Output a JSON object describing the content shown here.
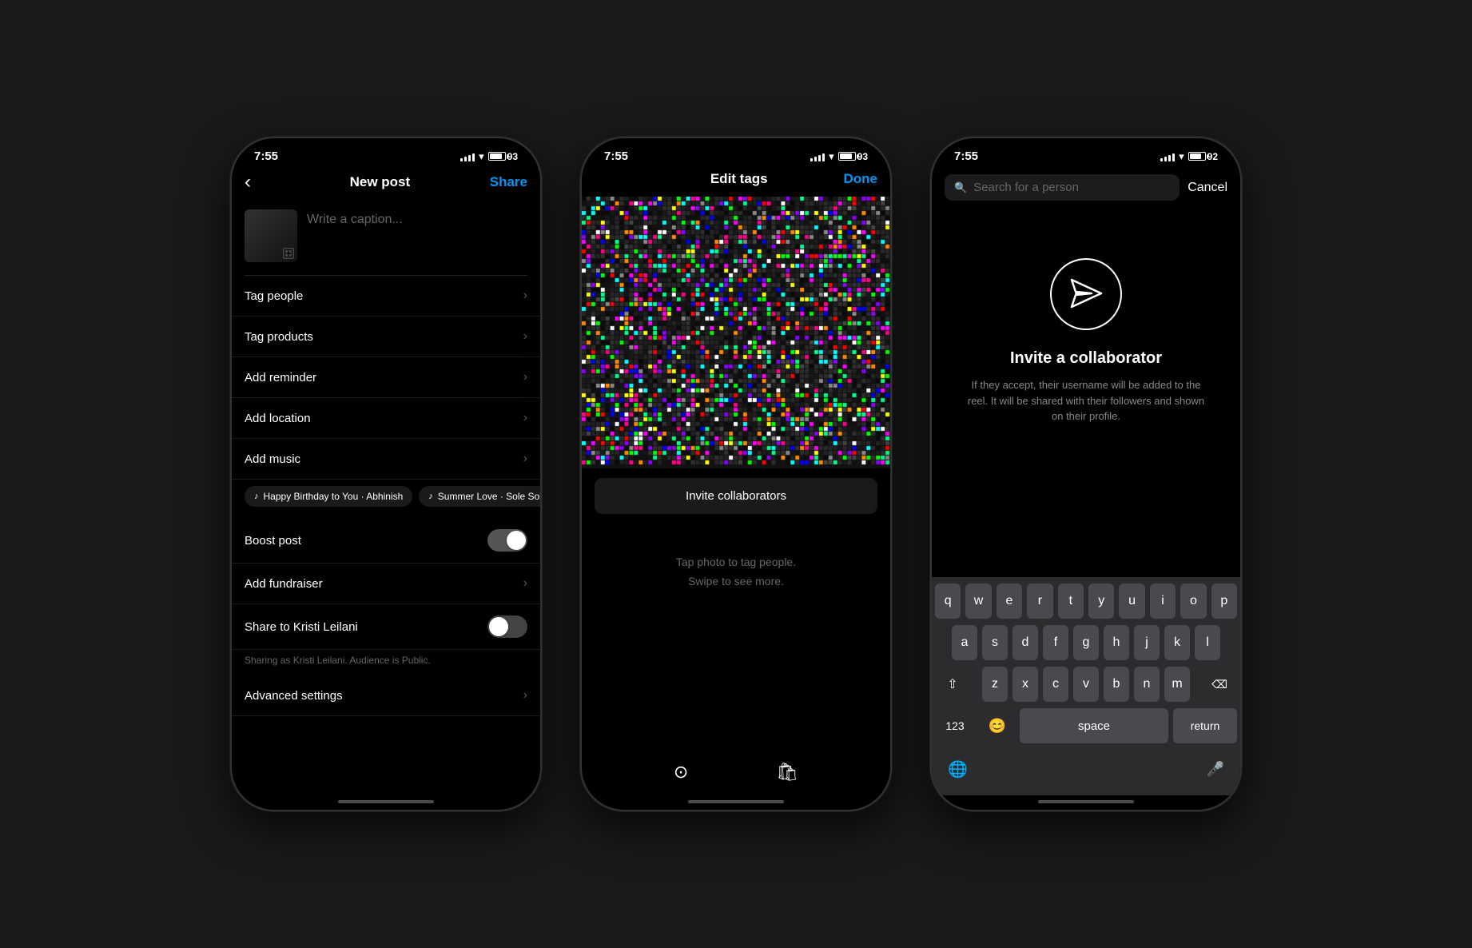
{
  "phone1": {
    "status": {
      "time": "7:55",
      "battery": "93"
    },
    "nav": {
      "back": "‹",
      "title": "New post",
      "share": "Share"
    },
    "caption_placeholder": "Write a caption...",
    "menu_items": [
      {
        "label": "Tag people"
      },
      {
        "label": "Tag products"
      },
      {
        "label": "Add reminder"
      },
      {
        "label": "Add location"
      },
      {
        "label": "Add music"
      }
    ],
    "music_chips": [
      {
        "text": "Happy Birthday to You · Abhinish"
      },
      {
        "text": "Summer Love · Sole Sole"
      }
    ],
    "boost_post": "Boost post",
    "add_fundraiser": "Add fundraiser",
    "share_to": "Share to Kristi Leilani",
    "sharing_note": "Sharing as Kristi Leilani. Audience is Public.",
    "advanced_settings": "Advanced settings"
  },
  "phone2": {
    "status": {
      "time": "7:55",
      "battery": "93"
    },
    "nav": {
      "title": "Edit tags",
      "done": "Done"
    },
    "invite_collab_btn": "Invite collaborators",
    "tap_hint": "Tap photo to tag people.",
    "swipe_hint": "Swipe to see more."
  },
  "phone3": {
    "status": {
      "time": "7:55",
      "battery": "92"
    },
    "search_placeholder": "Search for a person",
    "cancel": "Cancel",
    "invite_title": "Invite a collaborator",
    "invite_desc": "If they accept, their username will be added to the reel. It will be shared with their followers and shown on their profile.",
    "keyboard": {
      "row1": [
        "q",
        "w",
        "e",
        "r",
        "t",
        "y",
        "u",
        "i",
        "o",
        "p"
      ],
      "row2": [
        "a",
        "s",
        "d",
        "f",
        "g",
        "h",
        "j",
        "k",
        "l"
      ],
      "row3": [
        "z",
        "x",
        "c",
        "v",
        "b",
        "n",
        "m"
      ],
      "space": "space",
      "return": "return",
      "num": "123"
    }
  }
}
